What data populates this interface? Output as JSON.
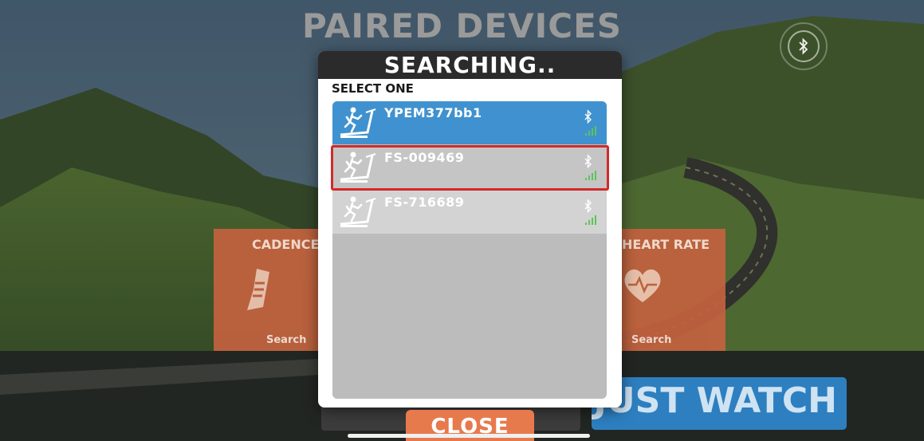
{
  "page": {
    "title": "PAIRED DEVICES"
  },
  "bluetooth_button": {
    "icon": "bluetooth-icon"
  },
  "tiles": [
    {
      "id": "cadence",
      "title": "CADENCE",
      "action": "Search",
      "icon": "shoe-icon"
    },
    {
      "id": "heart_rate",
      "title": "HEART RATE",
      "action": "Search",
      "icon": "heart-icon"
    }
  ],
  "buttons": {
    "just_watch": "JUST WATCH",
    "pair": "",
    "close": "CLOSE"
  },
  "modal": {
    "title": "SEARCHING..",
    "select_label": "SELECT ONE",
    "devices": [
      {
        "name": "YPEM377bb1",
        "icon": "treadmill-runner-icon",
        "signal": "bluetooth-signal-icon",
        "state": "selected"
      },
      {
        "name": "FS-009469",
        "icon": "treadmill-runner-icon",
        "signal": "bluetooth-signal-icon",
        "state": "highlighted"
      },
      {
        "name": "FS-716689",
        "icon": "treadmill-runner-icon",
        "signal": "bluetooth-signal-icon",
        "state": "faded"
      }
    ]
  },
  "colors": {
    "accent_orange": "#e77a4d",
    "selected_blue": "#3f92cf",
    "highlight_red": "#d32a2a",
    "watch_blue": "#2d7fc0"
  }
}
